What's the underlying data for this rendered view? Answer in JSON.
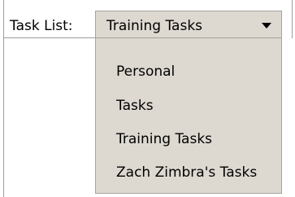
{
  "toolbar": {
    "task_list_label": "Task List:",
    "selected_value": "Training Tasks"
  },
  "dropdown": {
    "items": [
      {
        "label": "Personal"
      },
      {
        "label": "Tasks"
      },
      {
        "label": "Training Tasks"
      },
      {
        "label": "Zach Zimbra's Tasks"
      }
    ]
  },
  "icons": {
    "arrow": "chevron-down-icon"
  },
  "colors": {
    "select_bg": "#ddd9d1",
    "border": "#a6a39c"
  }
}
